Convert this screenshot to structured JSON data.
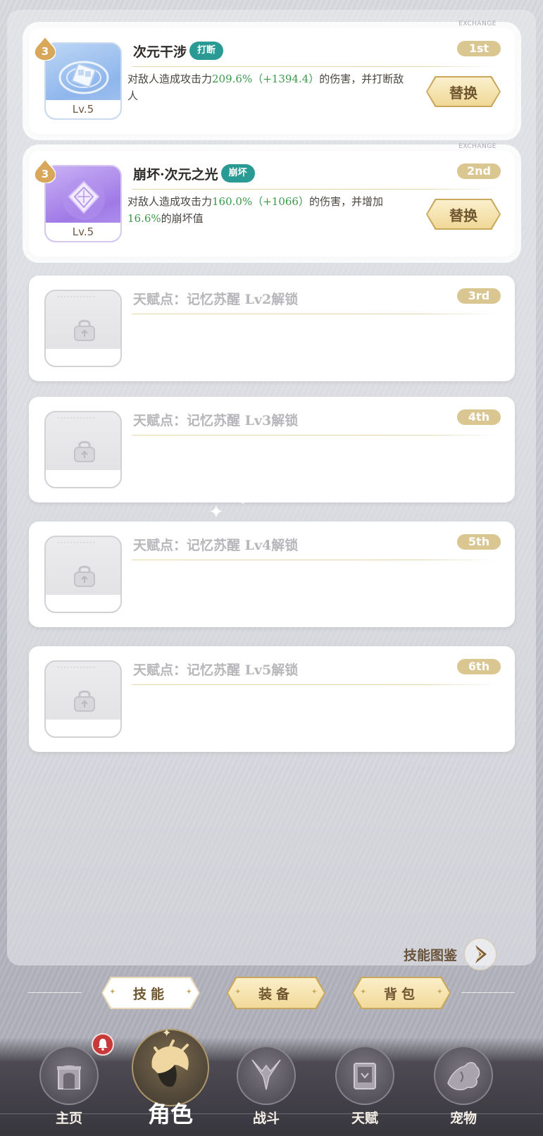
{
  "skill_slots": [
    {
      "exchange_label": "EXCHANGE",
      "badge": "3",
      "level": "Lv.5",
      "name": "次元干涉",
      "tag": "打断",
      "rank": "1st",
      "desc_pre": "对敌人造成攻击力",
      "desc_value1": "209.6%（+1394.4）",
      "desc_post": "的伤害，并打断敌人",
      "swap_label": "替换",
      "icon_theme": "blue"
    },
    {
      "exchange_label": "EXCHANGE",
      "badge": "3",
      "level": "Lv.5",
      "name": "崩坏·次元之光",
      "tag": "崩坏",
      "rank": "2nd",
      "desc_pre": "对敌人造成攻击力",
      "desc_value1": "160.0%（+1066）",
      "desc_mid": "的伤害，并增加",
      "desc_value2": "16.6%",
      "desc_post": "的崩坏值",
      "swap_label": "替换",
      "icon_theme": "purple"
    }
  ],
  "locked_slots": [
    {
      "label": "天赋点：记忆苏醒 Lv2解锁",
      "rank": "3rd"
    },
    {
      "label": "天赋点：记忆苏醒 Lv3解锁",
      "rank": "4th"
    },
    {
      "label": "天赋点：记忆苏醒 Lv4解锁",
      "rank": "5th"
    },
    {
      "label": "天赋点：记忆苏醒 Lv5解锁",
      "rank": "6th"
    }
  ],
  "codex_link": "技能图鉴",
  "tabs": [
    {
      "label": "技能",
      "selected": true
    },
    {
      "label": "装备",
      "selected": false
    },
    {
      "label": "背包",
      "selected": false
    }
  ],
  "nav": [
    {
      "label": "主页",
      "icon": "home-icon",
      "active": false
    },
    {
      "label": "角色",
      "icon": "character-icon",
      "active": true
    },
    {
      "label": "战斗",
      "icon": "battle-icon",
      "active": false
    },
    {
      "label": "天赋",
      "icon": "talent-book-icon",
      "active": false
    },
    {
      "label": "宠物",
      "icon": "pet-icon",
      "active": false
    }
  ],
  "colors": {
    "accent_gold": "#d9c691",
    "tag_teal": "#2a9a95",
    "value_green": "#3a9a4a",
    "notification_red": "#c8393a"
  }
}
